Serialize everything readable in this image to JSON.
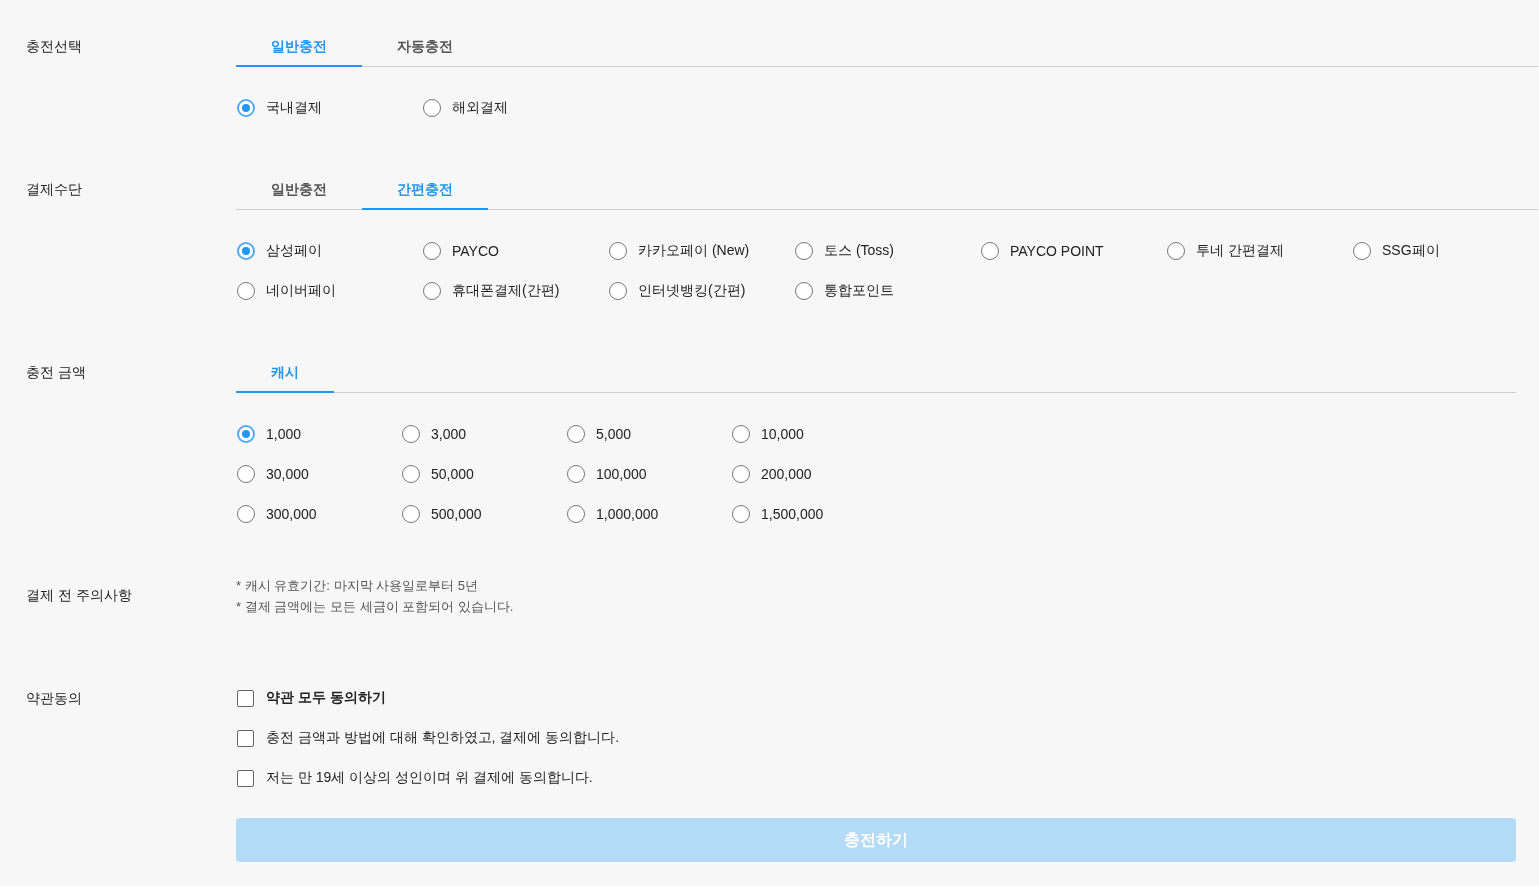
{
  "sections": [
    {
      "kind": "choice",
      "label": "충전선택",
      "tabs": [
        {
          "label": "일반충전",
          "selected": true
        },
        {
          "label": "자동충전",
          "selected": false
        }
      ],
      "options": [
        {
          "label": "국내결제",
          "selected": true
        },
        {
          "label": "해외결제",
          "selected": false
        }
      ]
    },
    {
      "kind": "choice",
      "label": "결제수단",
      "tabs": [
        {
          "label": "일반충전",
          "selected": false
        },
        {
          "label": "간편충전",
          "selected": true
        }
      ],
      "options": [
        {
          "label": "삼성페이",
          "selected": true
        },
        {
          "label": "PAYCO",
          "selected": false
        },
        {
          "label": "카카오페이 (New)",
          "selected": false
        },
        {
          "label": "토스 (Toss)",
          "selected": false
        },
        {
          "label": "PAYCO POINT",
          "selected": false
        },
        {
          "label": "투네 간편결제",
          "selected": false
        },
        {
          "label": "SSG페이",
          "selected": false
        },
        {
          "label": "네이버페이",
          "selected": false
        },
        {
          "label": "휴대폰결제(간편)",
          "selected": false
        },
        {
          "label": "인터넷뱅킹(간편)",
          "selected": false
        },
        {
          "label": "통합포인트",
          "selected": false
        }
      ]
    },
    {
      "kind": "amount",
      "label": "충전 금액",
      "tabs": [
        {
          "label": "캐시",
          "selected": true
        }
      ],
      "options": [
        {
          "label": "1,000",
          "selected": true
        },
        {
          "label": "3,000",
          "selected": false
        },
        {
          "label": "5,000",
          "selected": false
        },
        {
          "label": "10,000",
          "selected": false
        },
        {
          "label": "30,000",
          "selected": false
        },
        {
          "label": "50,000",
          "selected": false
        },
        {
          "label": "100,000",
          "selected": false
        },
        {
          "label": "200,000",
          "selected": false
        },
        {
          "label": "300,000",
          "selected": false
        },
        {
          "label": "500,000",
          "selected": false
        },
        {
          "label": "1,000,000",
          "selected": false
        },
        {
          "label": "1,500,000",
          "selected": false
        }
      ]
    },
    {
      "kind": "notes",
      "label": "결제 전 주의사항",
      "notes": [
        "* 캐시 유효기간: 마지막 사용일로부터 5년",
        "* 결제 금액에는 모든 세금이 포함되어 있습니다."
      ]
    },
    {
      "kind": "agreement",
      "label": "약관동의",
      "agreements": [
        {
          "kind": "all",
          "label": "약관 모두 동의하기",
          "checked": false
        },
        {
          "kind": "item",
          "label": "충전 금액과 방법에 대해 확인하였고, 결제에 동의합니다.",
          "checked": false
        },
        {
          "kind": "item",
          "label": "저는 만 19세 이상의 성인이며 위 결제에 동의합니다.",
          "checked": false
        }
      ],
      "button": {
        "label": "충전하기",
        "disabled": true
      }
    }
  ]
}
